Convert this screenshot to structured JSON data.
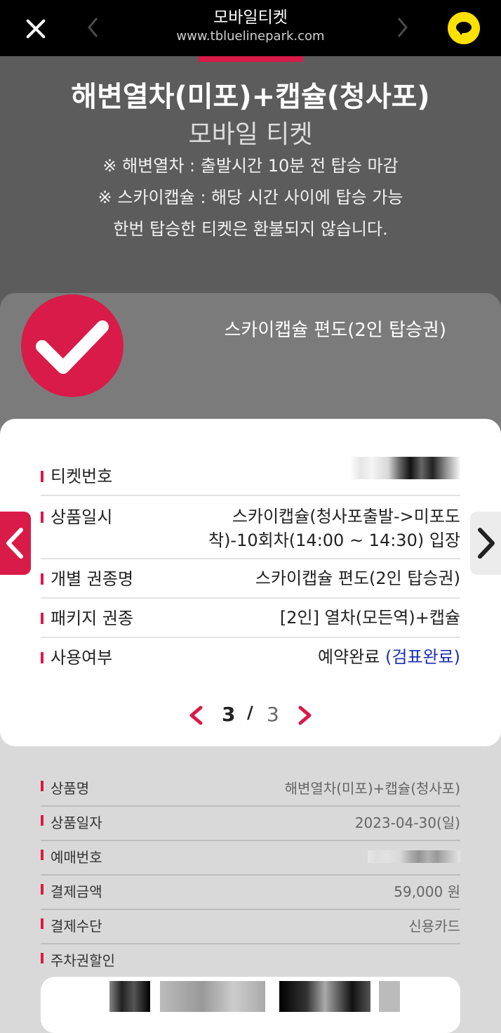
{
  "topbar": {
    "title": "모바일티켓",
    "url": "www.tbluelinepark.com",
    "icons": [
      "close-icon",
      "chevron-left-icon",
      "chevron-right-icon",
      "kakao-chat-icon"
    ]
  },
  "header": {
    "title": "해변열차(미포)+캡슐(청사포)",
    "subtitle": "모바일 티켓",
    "notes": [
      "※ 해변열차 : 출발시간 10분 전 탑승 마감",
      "※ 스카이캡슐 : 해당 시간 사이에 탑승 가능",
      "한번 탑승한 티켓은 환불되지 않습니다."
    ]
  },
  "ticket": {
    "name": "스카이캡슐 편도(2인 탑승권)",
    "rows": [
      {
        "label": "티켓번호",
        "value": ""
      },
      {
        "label": "상품일시",
        "value_line1": "스카이캡슐(청사포출발->미포도",
        "value_line2": "착)-10회차(14:00 ~ 14:30) 입장"
      },
      {
        "label": "개별 권종명",
        "value": "스카이캡슐 편도(2인 탑승권)"
      },
      {
        "label": "패키지 권종",
        "value": "[2인] 열차(모든역)+캡슐"
      },
      {
        "label": "사용여부",
        "value": "예약완료",
        "status": "(검표완료)"
      }
    ],
    "pager": {
      "current": "3",
      "separator": "/",
      "total": "3"
    }
  },
  "info": [
    {
      "label": "상품명",
      "value": "해변열차(미포)+캡슐(청사포)"
    },
    {
      "label": "상품일자",
      "value": "2023-04-30(일)"
    },
    {
      "label": "예매번호",
      "value": ""
    },
    {
      "label": "결제금액",
      "value": "59,000 원"
    },
    {
      "label": "결제수단",
      "value": "신용카드"
    },
    {
      "label": "주차권할인",
      "value": ""
    }
  ],
  "colors": {
    "accent": "#d81b48",
    "status_blue": "#1c2fb0",
    "kakao": "#fae100"
  }
}
